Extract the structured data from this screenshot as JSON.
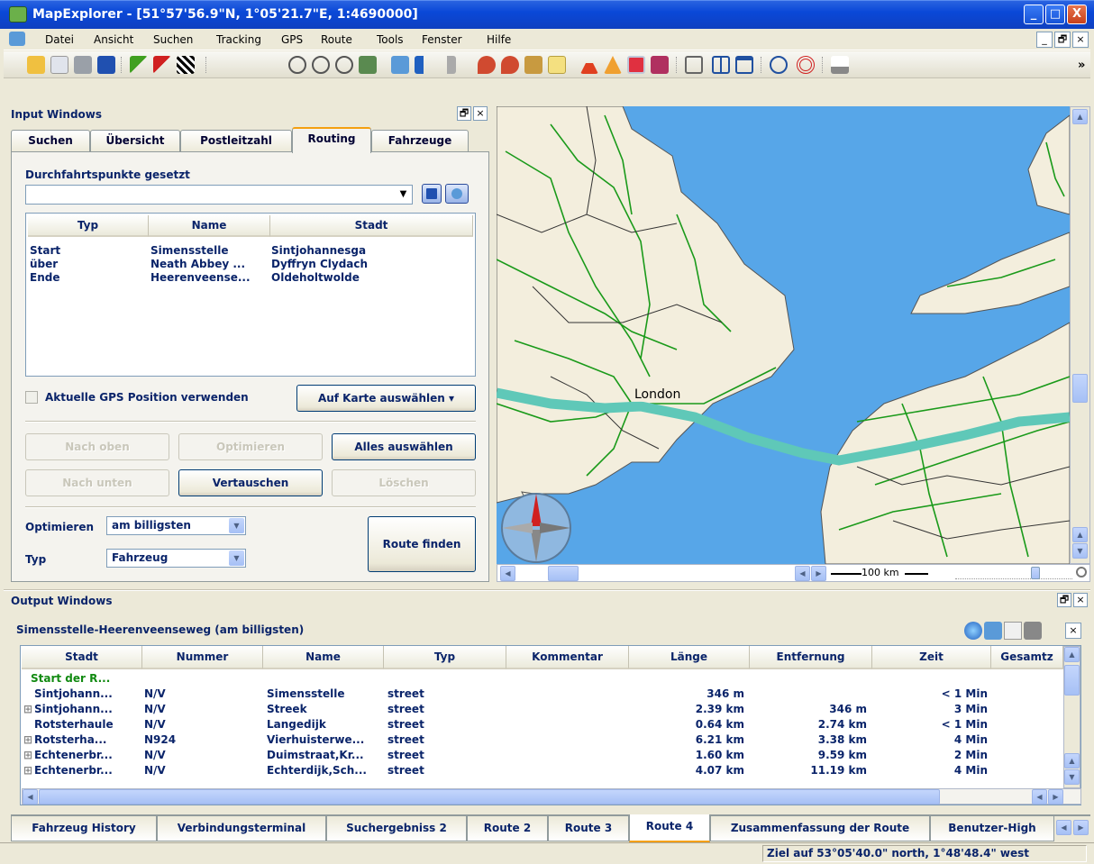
{
  "window": {
    "title": "MapExplorer - [51°57'56.9\"N, 1°05'21.7\"E, 1:4690000]",
    "minimize": "_",
    "maximize": "□",
    "close": "X"
  },
  "menu": {
    "items": [
      "Datei",
      "Ansicht",
      "Suchen",
      "Tracking",
      "GPS",
      "Route",
      "Tools",
      "Fenster",
      "Hilfe"
    ],
    "mdi_min": "_",
    "mdi_restore": "🗗",
    "mdi_close": "×"
  },
  "toolbar": {
    "overflow": "»"
  },
  "input_panel": {
    "title": "Input Windows",
    "tabs": [
      "Suchen",
      "Übersicht",
      "Postleitzahl",
      "Routing",
      "Fahrzeuge"
    ],
    "active_tab": "Routing",
    "waypoints_label": "Durchfahrtspunkte gesetzt",
    "waypoints_value": "",
    "columns": [
      "Typ",
      "Name",
      "Stadt"
    ],
    "rows": [
      [
        "Start",
        "Simensstelle",
        "Sintjohannesga"
      ],
      [
        "über",
        "Neath Abbey ...",
        "Dyffryn Clydach"
      ],
      [
        "Ende",
        "Heerenveense...",
        "Oldeholtwolde"
      ]
    ],
    "gps_checkbox": "Aktuelle GPS Position verwenden",
    "gps_checked": false,
    "select_on_map": "Auf Karte auswählen ▾",
    "btn_up": "Nach oben",
    "btn_optimize": "Optimieren",
    "btn_select_all": "Alles auswählen",
    "btn_down": "Nach unten",
    "btn_swap": "Vertauschen",
    "btn_delete": "Löschen",
    "optimize_label": "Optimieren",
    "optimize_value": "am billigsten",
    "type_label": "Typ",
    "type_value": "Fahrzeug",
    "find_route": "Route finden"
  },
  "map": {
    "city_label": "London",
    "scale_label": "100 km",
    "colors": {
      "water": "#57a6e8",
      "land": "#f3eedd",
      "route": "#5fc8b8",
      "roads": "#1a9a1a",
      "borders": "#333333"
    }
  },
  "output_panel": {
    "title": "Output Windows",
    "route_title": "Simensstelle-Heerenveenseweg (am billigsten)",
    "columns": [
      "Stadt",
      "Nummer",
      "Name",
      "Typ",
      "Kommentar",
      "Länge",
      "Entfernung",
      "Zeit",
      "Gesamtz"
    ],
    "start_row": "Start der R...",
    "rows": [
      {
        "expand": "",
        "stadt": "Sintjohann...",
        "nummer": "N/V",
        "name": "Simensstelle",
        "typ": "street",
        "kommentar": "",
        "laenge": "346 m",
        "entfernung": "",
        "zeit": "< 1 Min"
      },
      {
        "expand": "⊞",
        "stadt": "Sintjohann...",
        "nummer": "N/V",
        "name": "Streek",
        "typ": "street",
        "kommentar": "",
        "laenge": "2.39 km",
        "entfernung": "346 m",
        "zeit": "3 Min"
      },
      {
        "expand": "",
        "stadt": "Rotsterhaule",
        "nummer": "N/V",
        "name": "Langedijk",
        "typ": "street",
        "kommentar": "",
        "laenge": "0.64 km",
        "entfernung": "2.74 km",
        "zeit": "< 1 Min"
      },
      {
        "expand": "⊞",
        "stadt": "Rotsterha...",
        "nummer": "N924",
        "name": "Vierhuisterwe...",
        "typ": "street",
        "kommentar": "",
        "laenge": "6.21 km",
        "entfernung": "3.38 km",
        "zeit": "4 Min"
      },
      {
        "expand": "⊞",
        "stadt": "Echtenerbr...",
        "nummer": "N/V",
        "name": "Duimstraat,Kr...",
        "typ": "street",
        "kommentar": "",
        "laenge": "1.60 km",
        "entfernung": "9.59 km",
        "zeit": "2 Min"
      },
      {
        "expand": "⊞",
        "stadt": "Echtenerbr...",
        "nummer": "N/V",
        "name": "Echterdijk,Sch...",
        "typ": "street",
        "kommentar": "",
        "laenge": "4.07 km",
        "entfernung": "11.19 km",
        "zeit": "4 Min"
      }
    ]
  },
  "bottom_tabs": [
    "Fahrzeug History",
    "Verbindungsterminal",
    "Suchergebniss 2",
    "Route 2",
    "Route 3",
    "Route 4",
    "Zusammenfassung der Route",
    "Benutzer-High"
  ],
  "active_bottom_tab": "Route 4",
  "status": "Ziel auf 53°05'40.0\" north, 1°48'48.4\" west"
}
